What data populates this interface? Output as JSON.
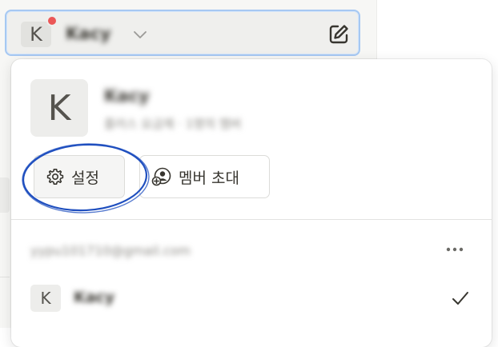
{
  "switcher": {
    "avatar_letter": "K",
    "workspace_name": "Kacy",
    "chevron_icon": "chevron-down-icon",
    "edit_icon": "compose-icon",
    "notification_color": "#eb5757"
  },
  "menu": {
    "workspace": {
      "avatar_letter": "K",
      "name": "Kacy",
      "subtitle": "플러스 요금제 · 1명의 멤버"
    },
    "actions": {
      "settings_label": "설정",
      "settings_icon": "gear-icon",
      "invite_label": "멤버 초대",
      "invite_icon": "add-person-icon"
    },
    "account": {
      "email": "yypu101710@gmail.com",
      "more_icon": "more-horizontal-icon",
      "workspaces": [
        {
          "avatar_letter": "K",
          "name": "Kacy",
          "selected": true
        }
      ],
      "check_icon": "check-icon"
    }
  },
  "colors": {
    "focus_ring": "#a6c8f2",
    "annotation_circle": "#1f4fbf"
  }
}
